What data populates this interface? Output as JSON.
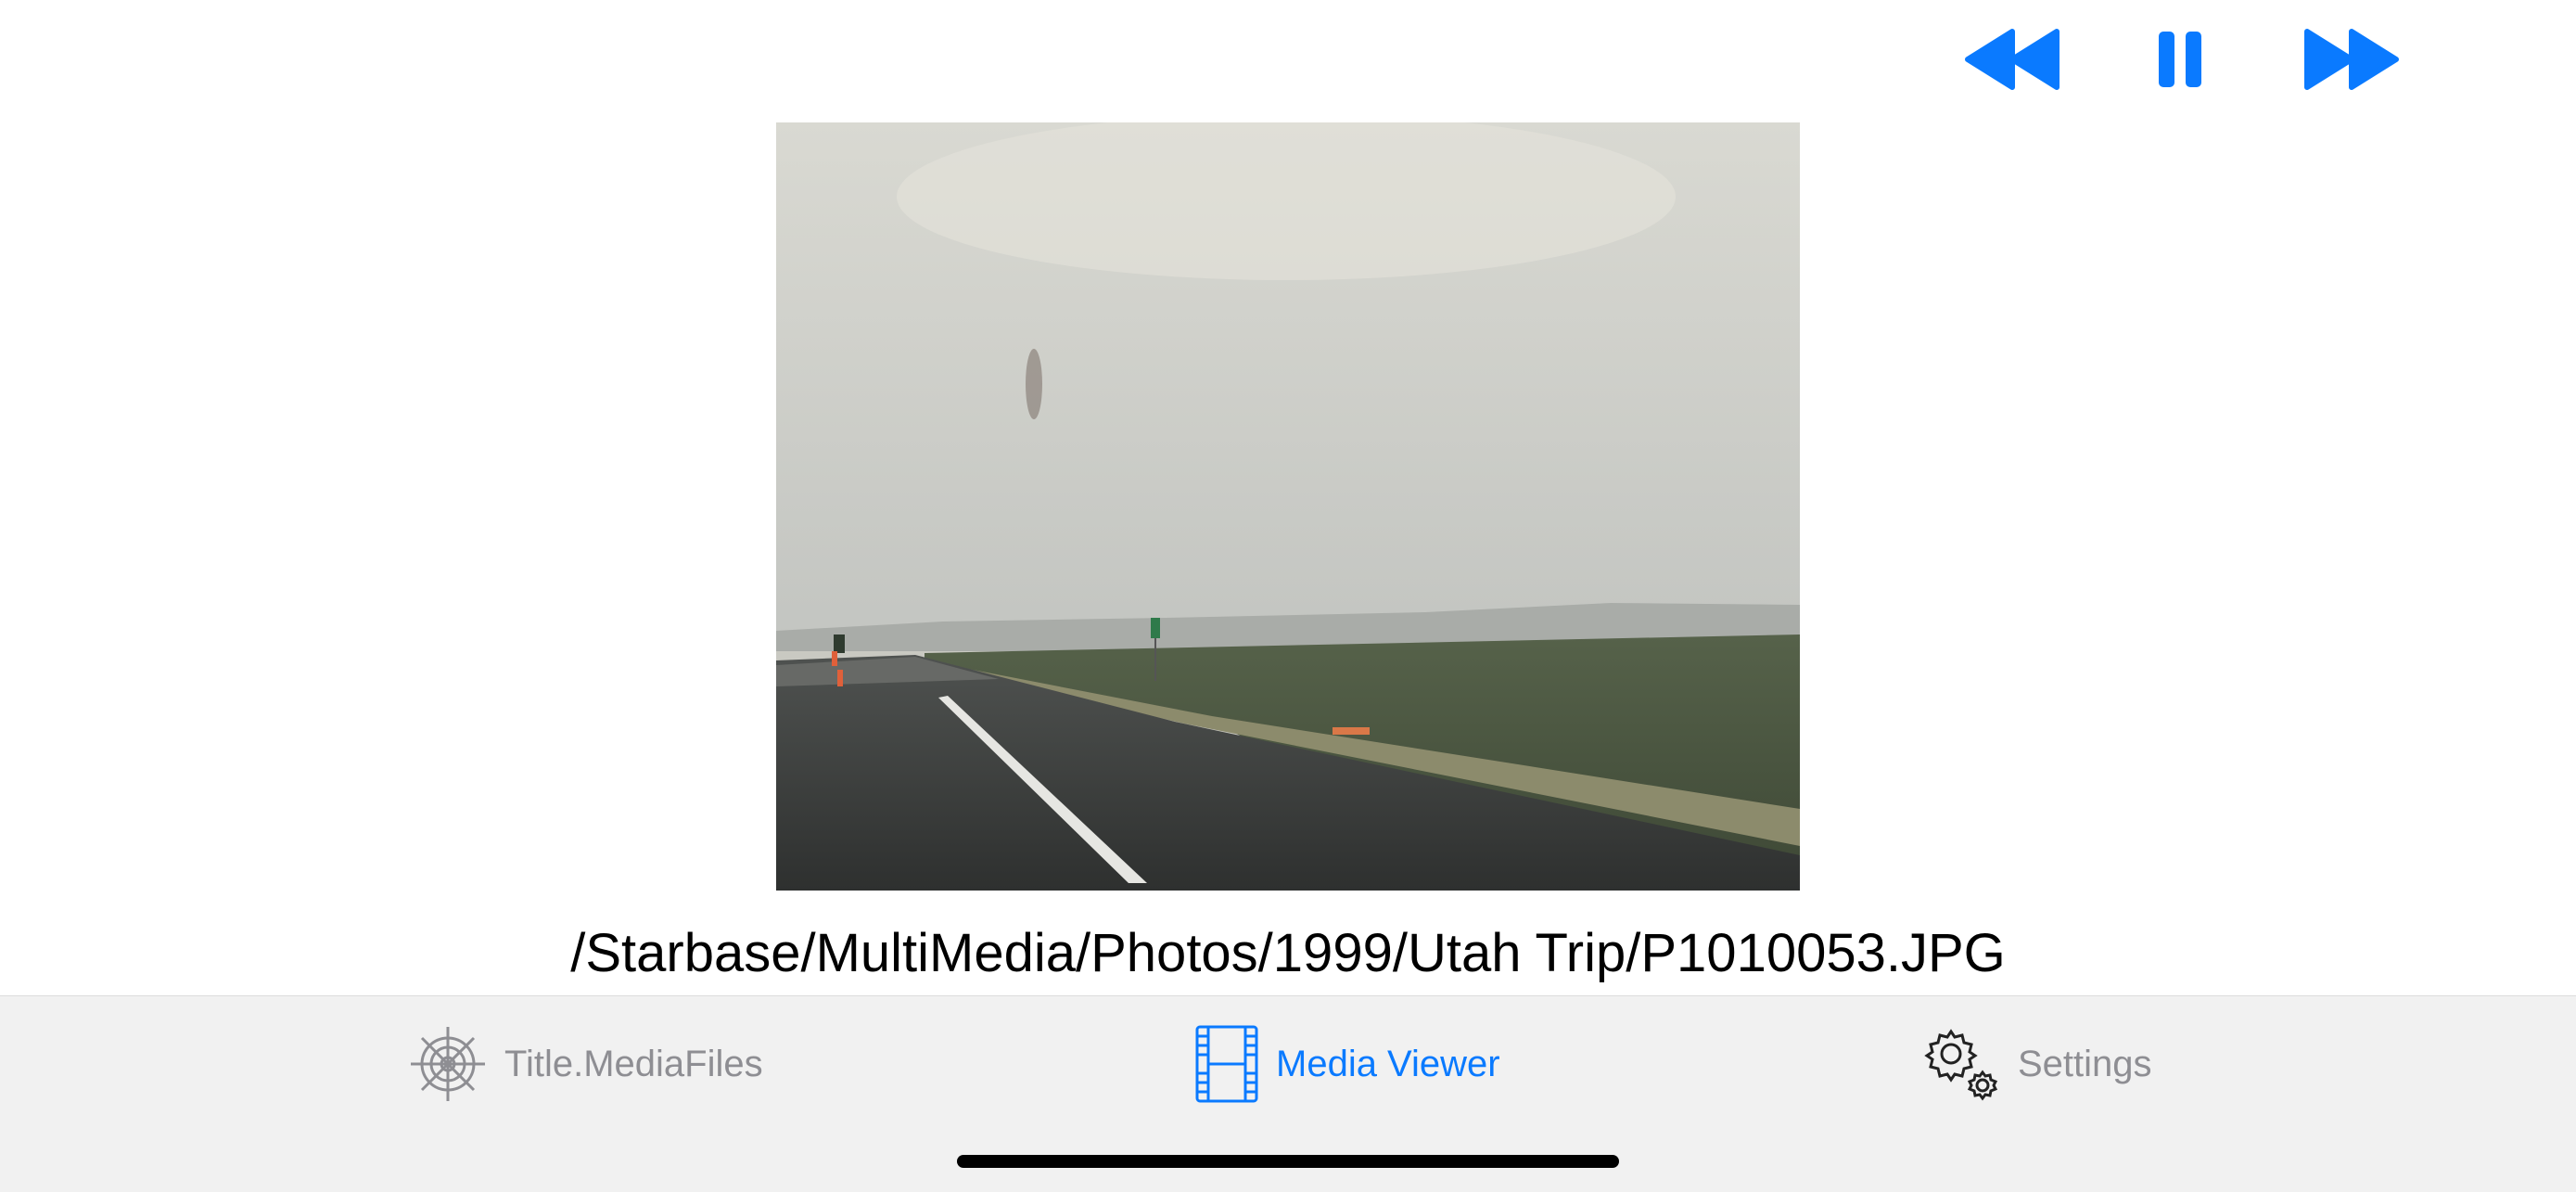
{
  "controls": {
    "rewind_icon": "rewind-icon",
    "pause_icon": "pause-icon",
    "forward_icon": "fast-forward-icon",
    "accent": "#0a7aff"
  },
  "photo": {
    "path": "/Starbase/MultiMedia/Photos/1999/Utah Trip/P1010053.JPG"
  },
  "tabbar": {
    "tabs": [
      {
        "label": "Title.MediaFiles",
        "icon": "ship-wheel-icon",
        "selected": false
      },
      {
        "label": "Media Viewer",
        "icon": "film-strip-icon",
        "selected": true
      },
      {
        "label": "Settings",
        "icon": "gears-icon",
        "selected": false
      }
    ],
    "active_color": "#0a7aff",
    "inactive_color": "#8e8e93"
  }
}
